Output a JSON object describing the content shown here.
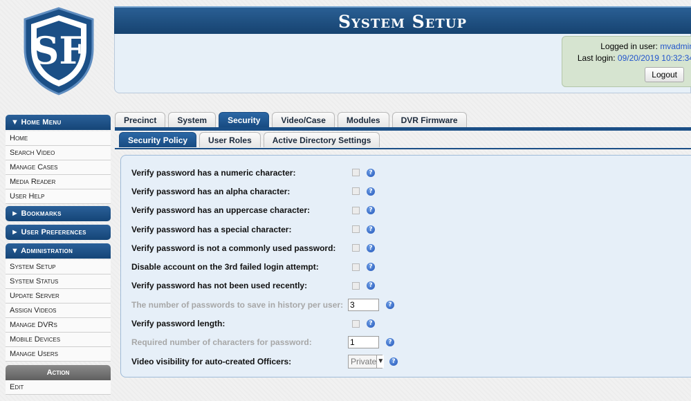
{
  "header": {
    "title": "System Setup"
  },
  "login": {
    "user_label": "Logged in user:",
    "user": "mvadmin",
    "last_label": "Last login:",
    "last": "09/20/2019 10:32:34",
    "logout": "Logout"
  },
  "logo": {
    "text": "SF",
    "icon": "shield-logo"
  },
  "sidebar": {
    "home_menu": "▼ Home Menu",
    "home_items": [
      "Home",
      "Search Video",
      "Manage Cases",
      "Media Reader",
      "User Help"
    ],
    "bookmarks": "► Bookmarks",
    "user_prefs": "► User Preferences",
    "admin": "▼ Administration",
    "admin_items": [
      "System Setup",
      "System Status",
      "Update Server",
      "Assign Videos",
      "Manage DVRs",
      "Mobile Devices",
      "Manage Users"
    ],
    "action": "Action",
    "action_items": [
      "Edit"
    ]
  },
  "tabs": [
    "Precinct",
    "System",
    "Security",
    "Video/Case",
    "Modules",
    "DVR Firmware"
  ],
  "active_tab": "Security",
  "subtabs": [
    "Security Policy",
    "User Roles",
    "Active Directory Settings"
  ],
  "active_subtab": "Security Policy",
  "form": {
    "rows": [
      {
        "label": "Verify password has a numeric character:"
      },
      {
        "label": "Verify password has an alpha character:"
      },
      {
        "label": "Verify password has an uppercase character:"
      },
      {
        "label": "Verify password has a special character:"
      },
      {
        "label": "Verify password is not a commonly used password:"
      },
      {
        "label": "Disable account on the 3rd failed login attempt:"
      },
      {
        "label": "Verify password has not been used recently:"
      },
      {
        "label": "The number of passwords to save in history per user:",
        "value": "3"
      },
      {
        "label": "Verify password length:"
      },
      {
        "label": "Required number of characters for password:",
        "value": "1"
      },
      {
        "label": "Video visibility for auto-created Officers:",
        "value": "Private"
      }
    ]
  },
  "colors": {
    "brand_blue": "#1b4f86",
    "link_blue": "#2255cc"
  }
}
